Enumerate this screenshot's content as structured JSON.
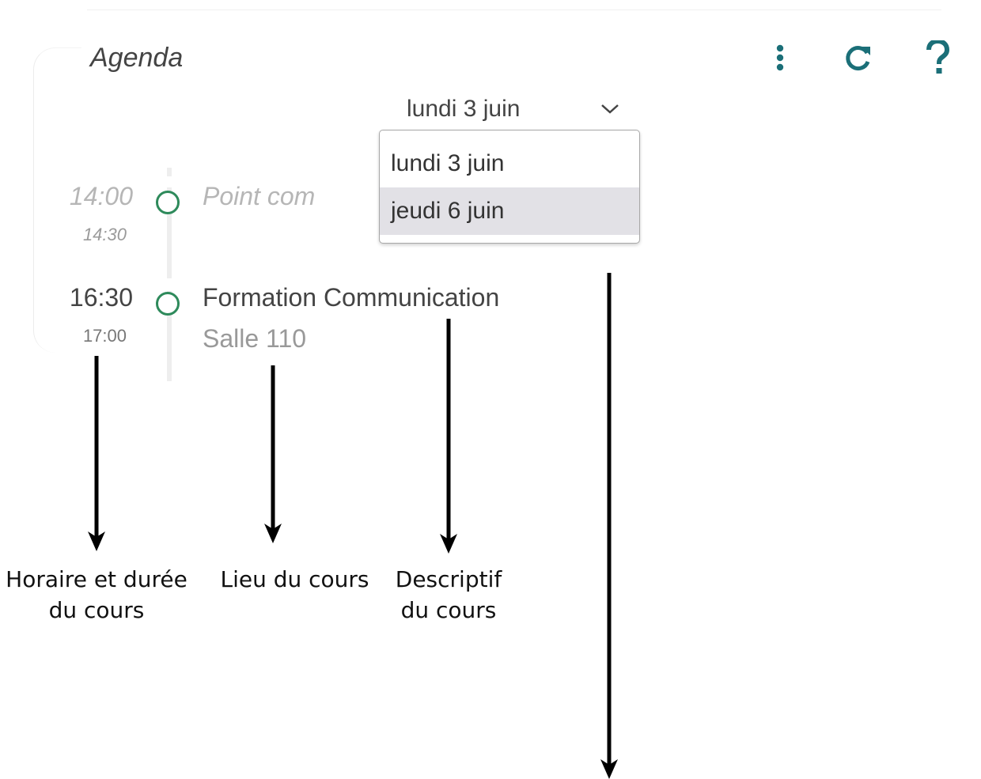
{
  "widget": {
    "title": "Agenda"
  },
  "toolbar": {
    "icons": [
      "more-vertical-icon",
      "refresh-icon",
      "help-icon"
    ],
    "accent_color": "#1b6f78"
  },
  "date_select": {
    "selected": "lundi 3 juin",
    "options": [
      {
        "label": "lundi 3 juin",
        "highlighted": false
      },
      {
        "label": "jeudi 6 juin",
        "highlighted": true
      }
    ]
  },
  "events": [
    {
      "start": "14:00",
      "end": "14:30",
      "title": "Point com",
      "room": "",
      "status": "past"
    },
    {
      "start": "16:30",
      "end": "17:00",
      "title": "Formation Communication",
      "room": "Salle 110",
      "status": "upcoming"
    }
  ],
  "marker_color": "#2e8a5b",
  "annotations": {
    "horaire_line1": "Horaire et durée",
    "horaire_line2": "du cours",
    "lieu": "Lieu du cours",
    "descriptif_line1": "Descriptif",
    "descriptif_line2": "du cours"
  }
}
